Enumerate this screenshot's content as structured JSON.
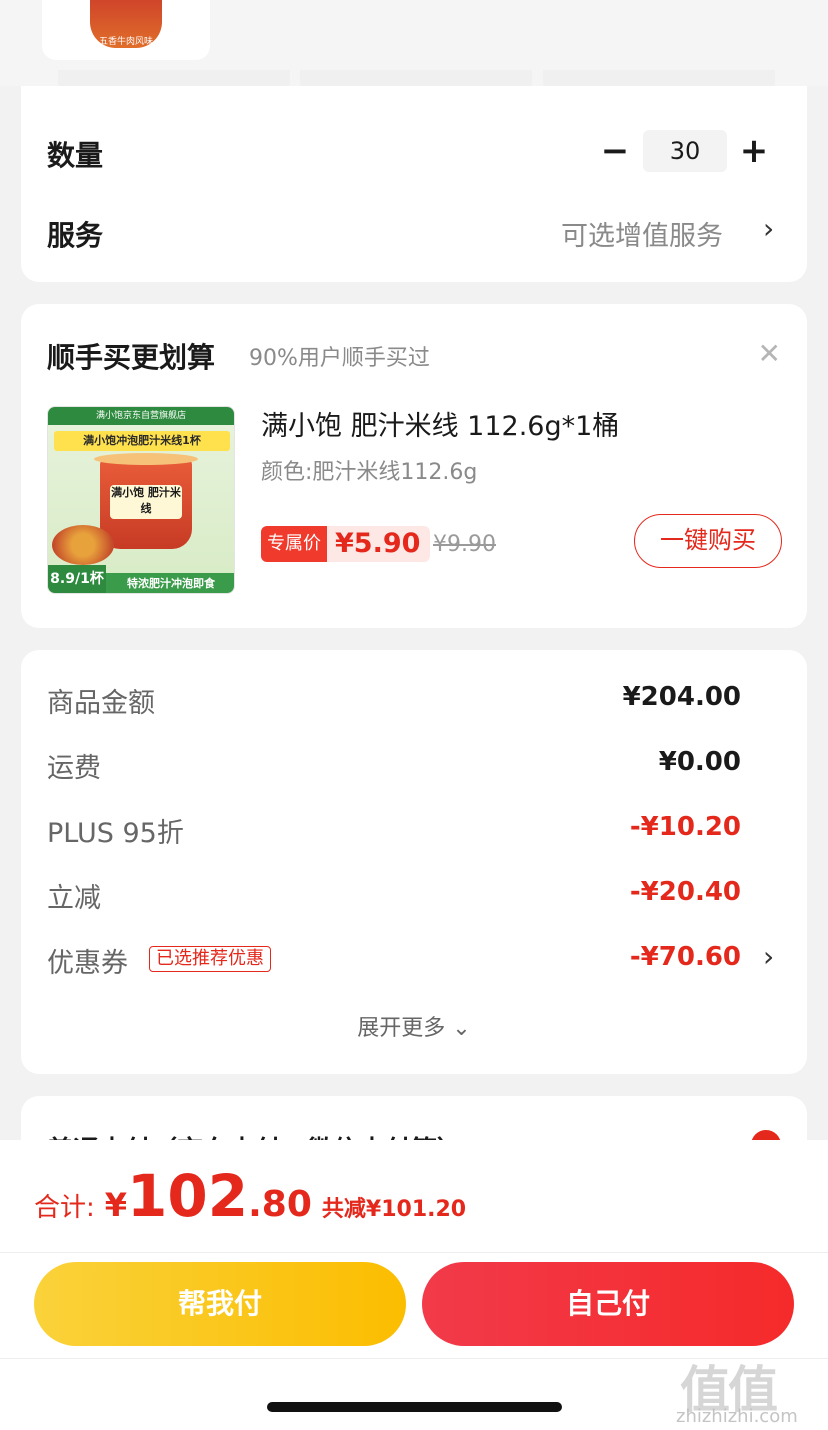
{
  "top": {
    "thumb_label": "五香牛肉风味"
  },
  "quantity": {
    "label": "数量",
    "minus": "−",
    "value": "30",
    "plus": "+"
  },
  "service": {
    "label": "服务",
    "value": "可选增值服务",
    "chevron": "›"
  },
  "recommend": {
    "title": "顺手买更划算",
    "subtitle": "90%用户顺手买过",
    "close": "✕",
    "product": {
      "image_band": "满小饱京东自营旗舰店",
      "image_head": "满小饱冲泡肥汁米线1杯",
      "image_cup_text": "满小饱 肥汁米线",
      "image_price": "8.9/1杯",
      "image_bottom": "特浓肥汁冲泡即食",
      "name": "满小饱 肥汁米线 112.6g*1桶",
      "spec": "颜色:肥汁米线112.6g",
      "badge": "专属价",
      "price": "¥5.90",
      "old_price": "¥9.90",
      "buy_label": "一键购买"
    }
  },
  "summary": {
    "rows": [
      {
        "label": "商品金额",
        "value": "¥204.00"
      },
      {
        "label": "运费",
        "value": "¥0.00"
      },
      {
        "label": "PLUS 95折",
        "value": "-¥10.20"
      },
      {
        "label": "立减",
        "value": "-¥20.40"
      },
      {
        "label": "优惠券",
        "value": "-¥70.60",
        "tag": "已选推荐优惠"
      }
    ],
    "expand": "展开更多 ⌄",
    "chevron": "›"
  },
  "payment": {
    "title": "普通支付（京东支付、微信支付等）"
  },
  "footer": {
    "total_label": "合计:",
    "yen": "¥",
    "total_int": "102",
    "total_dec": ".80",
    "saved": "共减¥101.20",
    "help_pay": "帮我付",
    "self_pay": "自己付"
  },
  "watermark": {
    "mark": "值值值",
    "site": "zhizhizhi.com"
  },
  "colors": {
    "accent_red": "#e4281c",
    "help_yellow": "#fbc416",
    "self_red": "#f23a3a"
  }
}
